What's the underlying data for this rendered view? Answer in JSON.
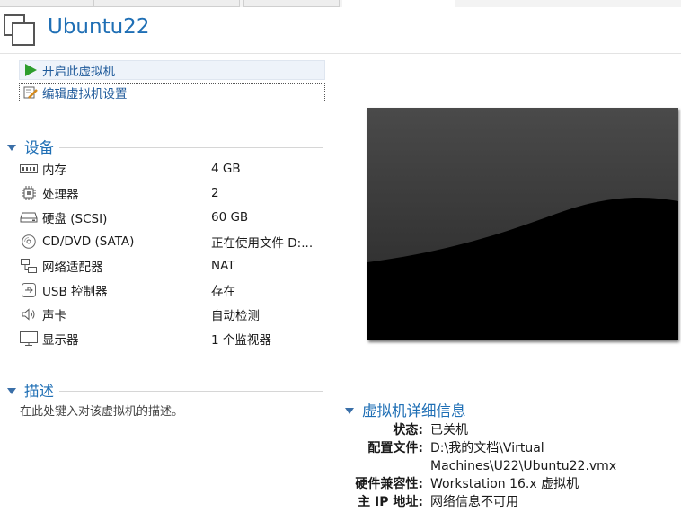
{
  "header": {
    "title": "Ubuntu22"
  },
  "actions": {
    "start_label": "开启此虚拟机",
    "edit_label": "编辑虚拟机设置"
  },
  "devices": {
    "section_label": "设备",
    "items": [
      {
        "icon": "memory-icon",
        "name": "内存",
        "value": "4 GB"
      },
      {
        "icon": "processor-icon",
        "name": "处理器",
        "value": "2"
      },
      {
        "icon": "hard-disk-icon",
        "name": "硬盘 (SCSI)",
        "value": "60 GB"
      },
      {
        "icon": "cd-dvd-icon",
        "name": "CD/DVD (SATA)",
        "value": "正在使用文件 D:..."
      },
      {
        "icon": "network-adapter-icon",
        "name": "网络适配器",
        "value": "NAT"
      },
      {
        "icon": "usb-icon",
        "name": "USB 控制器",
        "value": "存在"
      },
      {
        "icon": "sound-card-icon",
        "name": "声卡",
        "value": "自动检测"
      },
      {
        "icon": "display-icon",
        "name": "显示器",
        "value": "1 个监视器"
      }
    ]
  },
  "description": {
    "section_label": "描述",
    "placeholder": "在此处键入对该虚拟机的描述。"
  },
  "details": {
    "section_label": "虚拟机详细信息",
    "rows": [
      {
        "key": "状态:",
        "value": "已关机"
      },
      {
        "key": "配置文件:",
        "value": "D:\\我的文档\\Virtual Machines\\U22\\Ubuntu22.vmx"
      },
      {
        "key": "硬件兼容性:",
        "value": "Workstation 16.x 虚拟机"
      },
      {
        "key": "主 IP 地址:",
        "value": "网络信息不可用"
      }
    ]
  },
  "colors": {
    "title": "#1f6fb5",
    "action_text": "#1f5a9a",
    "play_green": "#2e9e2e"
  }
}
